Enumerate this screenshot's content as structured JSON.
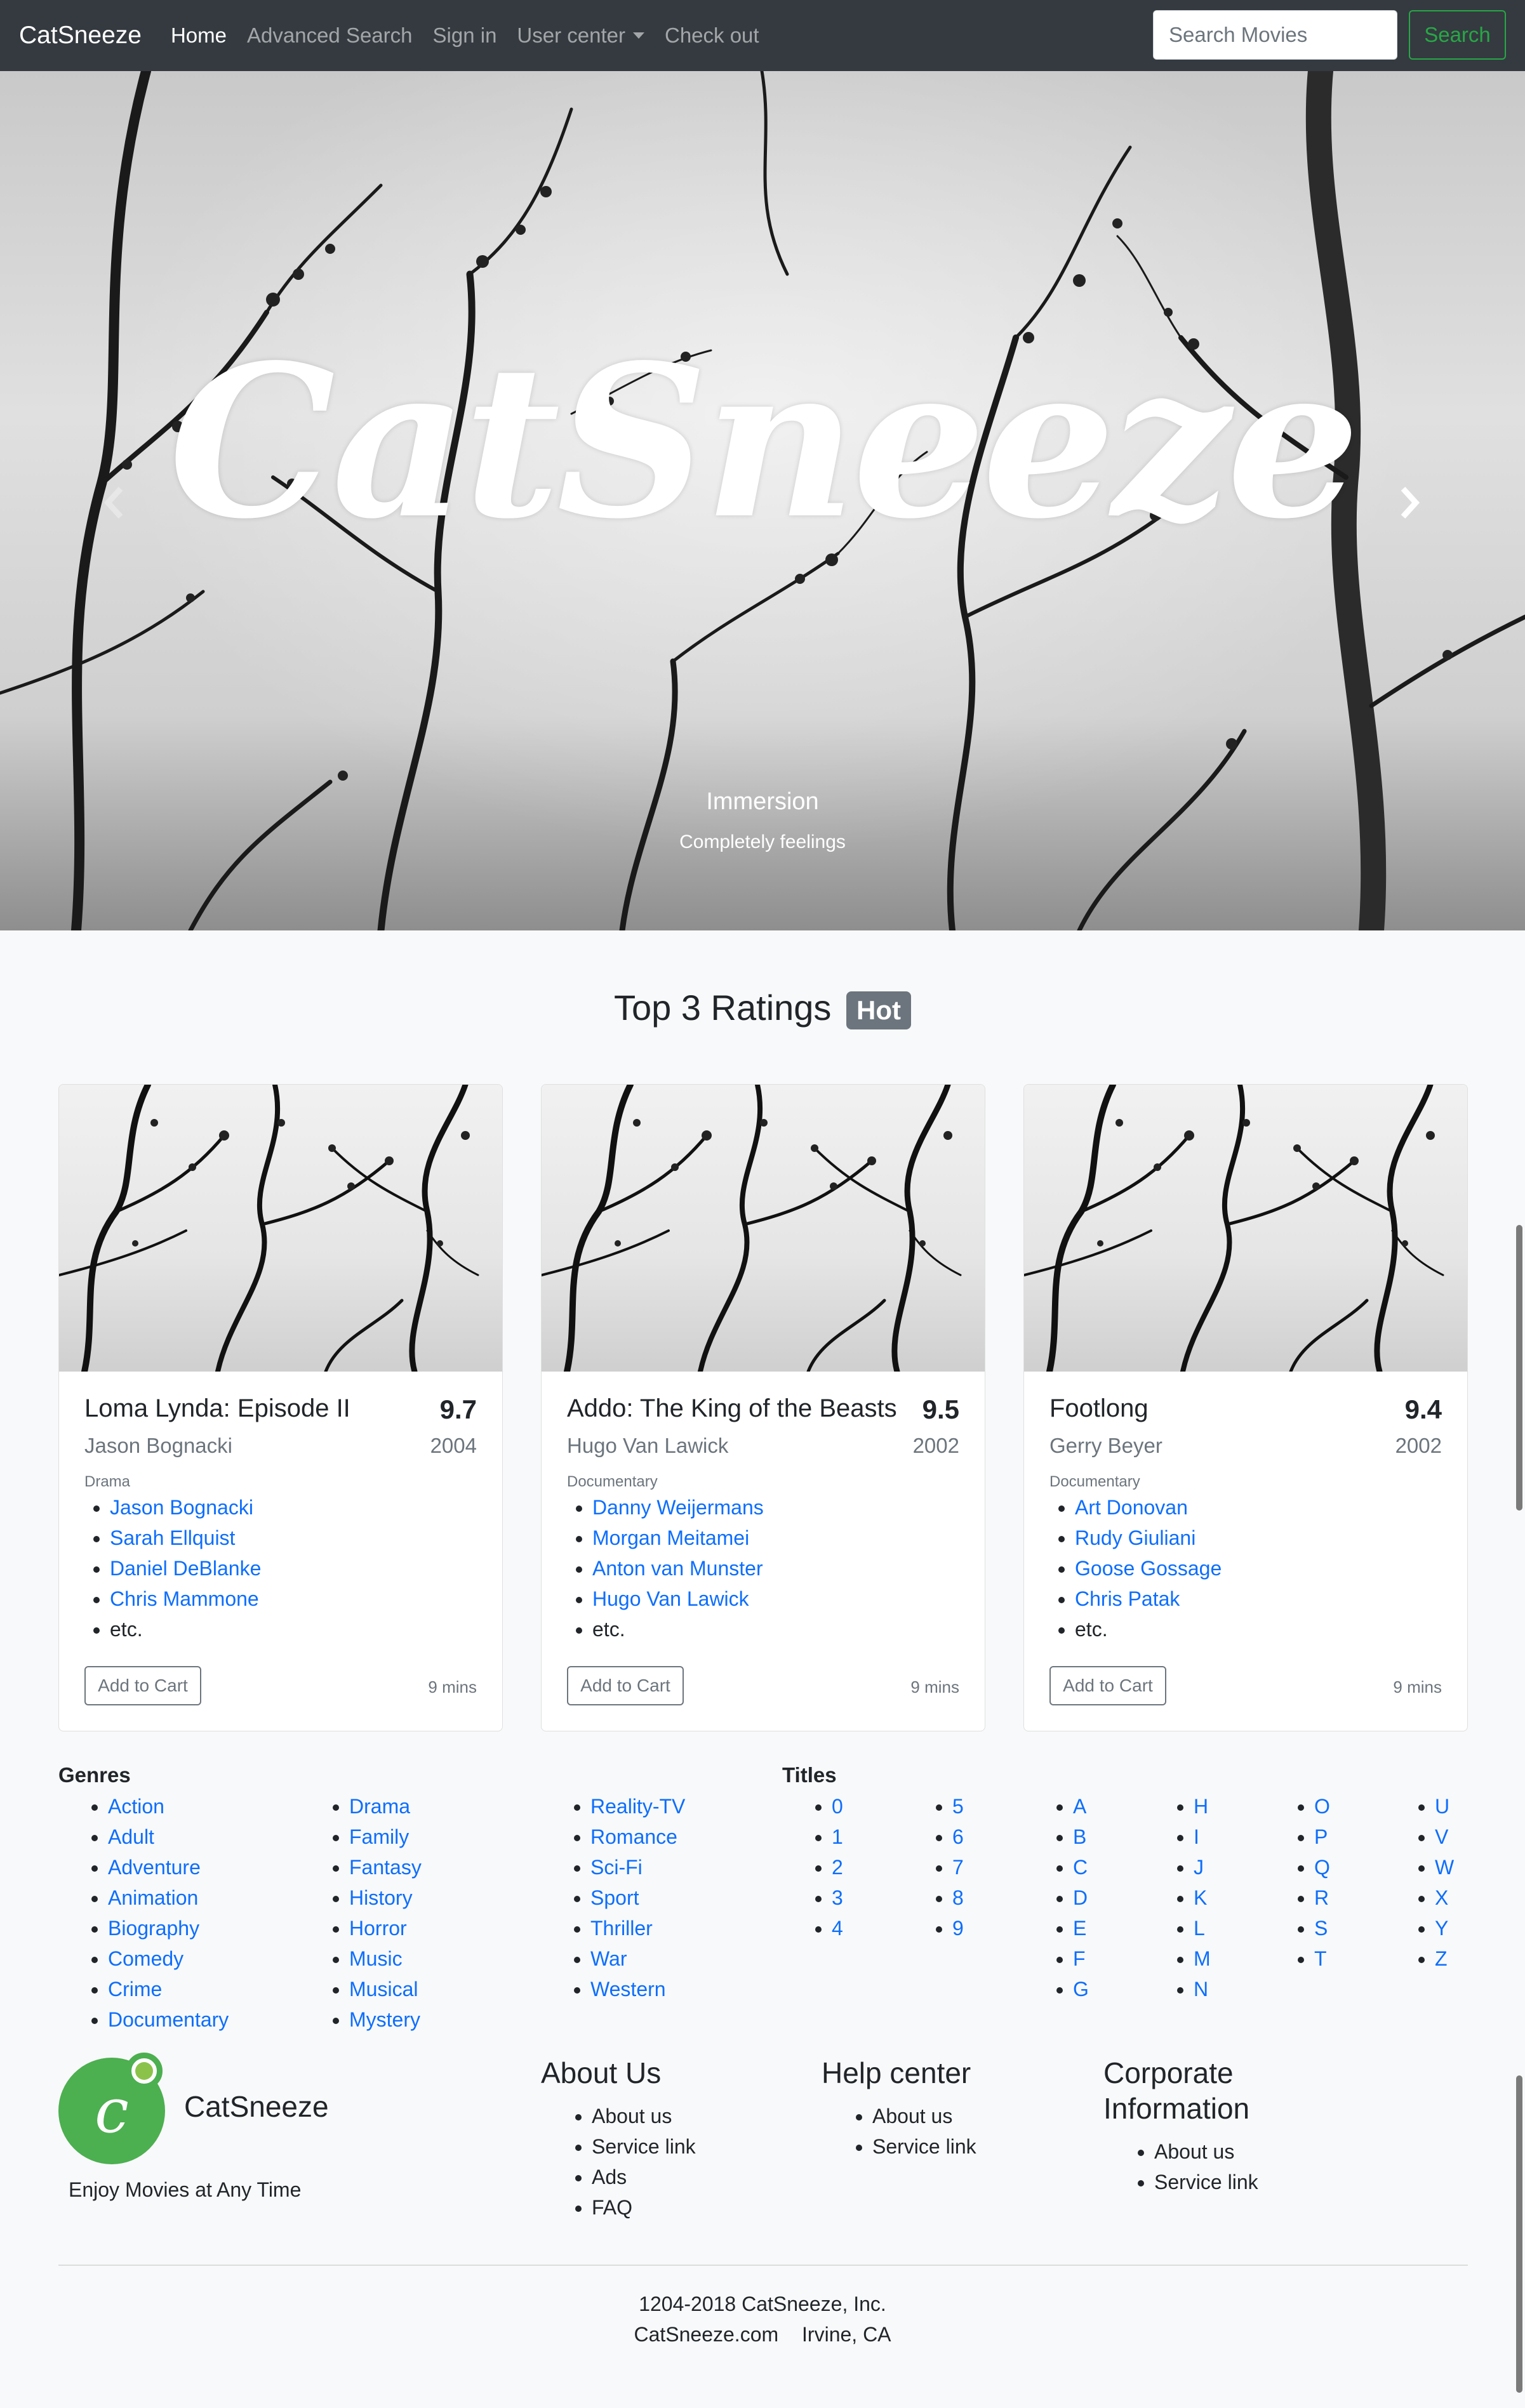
{
  "navbar": {
    "brand": "CatSneeze",
    "items": [
      {
        "label": "Home",
        "active": true
      },
      {
        "label": "Advanced Search"
      },
      {
        "label": "Sign in"
      },
      {
        "label": "User center",
        "dropdown": true
      },
      {
        "label": "Check out"
      }
    ],
    "search_placeholder": "Search Movies",
    "search_button": "Search"
  },
  "hero": {
    "title": "CatSneeze",
    "caption_title": "Immersion",
    "caption_subtitle": "Completely feelings",
    "prev_icon": "chevron-left-icon",
    "next_icon": "chevron-right-icon"
  },
  "top_ratings": {
    "title": "Top 3 Ratings",
    "badge": "Hot",
    "cards": [
      {
        "title": "Loma Lynda: Episode II",
        "rating": "9.7",
        "director": "Jason Bognacki",
        "year": "2004",
        "genre": "Drama",
        "stars": [
          "Jason Bognacki",
          "Sarah Ellquist",
          "Daniel DeBlanke",
          "Chris Mammone"
        ],
        "etc": "etc.",
        "cart": "Add to Cart",
        "duration": "9 mins"
      },
      {
        "title": "Addo: The King of the Beasts",
        "rating": "9.5",
        "director": "Hugo Van Lawick",
        "year": "2002",
        "genre": "Documentary",
        "stars": [
          "Danny Weijermans",
          "Morgan Meitamei",
          "Anton van Munster",
          "Hugo Van Lawick"
        ],
        "etc": "etc.",
        "cart": "Add to Cart",
        "duration": "9 mins"
      },
      {
        "title": "Footlong",
        "rating": "9.4",
        "director": "Gerry Beyer",
        "year": "2002",
        "genre": "Documentary",
        "stars": [
          "Art Donovan",
          "Rudy Giuliani",
          "Goose Gossage",
          "Chris Patak"
        ],
        "etc": "etc.",
        "cart": "Add to Cart",
        "duration": "9 mins"
      }
    ]
  },
  "genres": {
    "heading": "Genres",
    "columns": [
      [
        "Action",
        "Adult",
        "Adventure",
        "Animation",
        "Biography",
        "Comedy",
        "Crime",
        "Documentary"
      ],
      [
        "Drama",
        "Family",
        "Fantasy",
        "History",
        "Horror",
        "Music",
        "Musical",
        "Mystery"
      ],
      [
        "Reality-TV",
        "Romance",
        "Sci-Fi",
        "Sport",
        "Thriller",
        "War",
        "Western"
      ]
    ]
  },
  "titles": {
    "heading": "Titles",
    "columns": [
      [
        "0",
        "1",
        "2",
        "3",
        "4"
      ],
      [
        "5",
        "6",
        "7",
        "8",
        "9"
      ],
      [
        "A",
        "B",
        "C",
        "D",
        "E",
        "F",
        "G"
      ],
      [
        "H",
        "I",
        "J",
        "K",
        "L",
        "M",
        "N"
      ],
      [
        "O",
        "P",
        "Q",
        "R",
        "S",
        "T"
      ],
      [
        "U",
        "V",
        "W",
        "X",
        "Y",
        "Z"
      ]
    ]
  },
  "footer": {
    "logo_letter": "c",
    "brand": "CatSneeze",
    "tagline": "Enjoy Movies at Any Time",
    "sections": [
      {
        "heading": "About Us",
        "links": [
          "About us",
          "Service link",
          "Ads",
          "FAQ"
        ]
      },
      {
        "heading": "Help center",
        "links": [
          "About us",
          "Service link"
        ]
      },
      {
        "heading": "Corporate\nInformation",
        "links": [
          "About us",
          "Service link"
        ]
      }
    ],
    "copyright": "1204-2018 CatSneeze, Inc.",
    "site": "CatSneeze.com",
    "location": "Irvine, CA"
  },
  "colors": {
    "navbar": "#343a40",
    "link": "#0d6efd",
    "search_accent": "#28a745",
    "badge": "#6c757d",
    "logo": "#4caf50"
  }
}
